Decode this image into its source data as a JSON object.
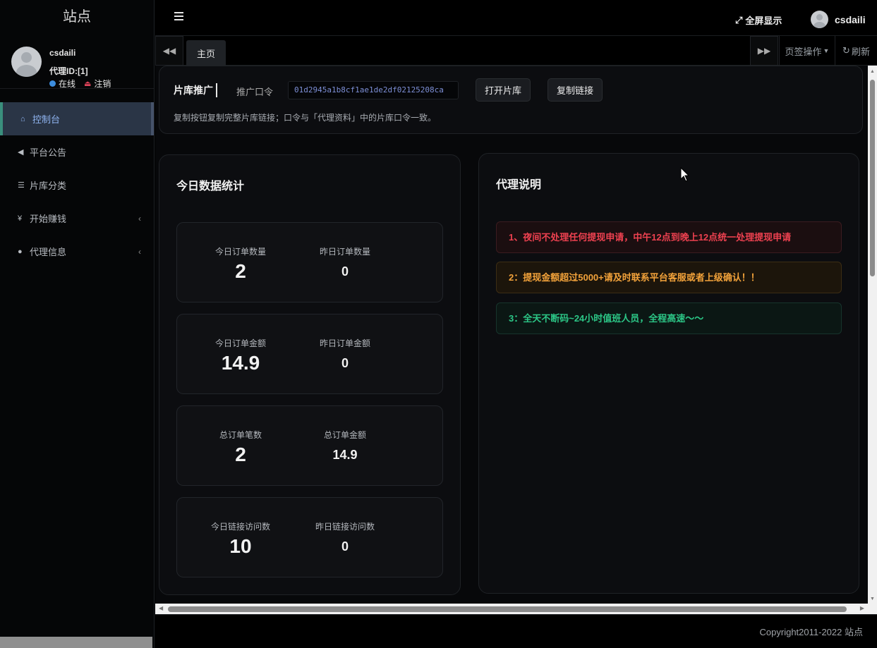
{
  "sidebar": {
    "logo": "站点",
    "user": {
      "name": "csdaili",
      "id_text": "代理ID:[1]",
      "status": "在线",
      "logout": "注销"
    },
    "menu": [
      {
        "label": "控制台",
        "icon": "home-icon",
        "glyph": "⌂",
        "active": true
      },
      {
        "label": "平台公告",
        "icon": "bullhorn-icon",
        "glyph": "◀",
        "active": false
      },
      {
        "label": "片库分类",
        "icon": "list-icon",
        "glyph": "☰",
        "active": false
      },
      {
        "label": "开始赚钱",
        "icon": "yen-icon",
        "glyph": "¥",
        "active": false,
        "expandable": true
      },
      {
        "label": "代理信息",
        "icon": "user-icon",
        "glyph": "●",
        "active": false,
        "expandable": true
      }
    ]
  },
  "header": {
    "fullscreen_label": "全屏显示",
    "user_name": "csdaili"
  },
  "tabbar": {
    "home_tab": "主页",
    "tab_ops": "页签操作",
    "refresh": "刷新"
  },
  "promo": {
    "title": "片库推广",
    "label": "推广口令",
    "code": "01d2945a1b8cf1ae1de2df02125208ca",
    "open_button": "打开片库",
    "copy_button": "复制链接",
    "description": "复制按钮复制完整片库链接；口令与「代理资料」中的片库口令一致。"
  },
  "stats": {
    "title": "今日数据统计",
    "cards": [
      {
        "left_label": "今日订单数量",
        "left_value": "2",
        "right_label": "昨日订单数量",
        "right_value": "0"
      },
      {
        "left_label": "今日订单金额",
        "left_value": "14.9",
        "right_label": "昨日订单金额",
        "right_value": "0"
      },
      {
        "left_label": "总订单笔数",
        "left_value": "2",
        "right_label": "总订单金额",
        "right_value": "14.9"
      },
      {
        "left_label": "今日链接访问数",
        "left_value": "10",
        "right_label": "昨日链接访问数",
        "right_value": "0"
      }
    ]
  },
  "agent_notes": {
    "title": "代理说明",
    "items": [
      {
        "text": "1、夜间不处理任何提现申请，中午12点到晚上12点统一处理提现申请",
        "color": "#ee4150"
      },
      {
        "text": "2：提现金额超过5000+请及时联系平台客服或者上级确认！！",
        "color": "#f2a23a"
      },
      {
        "text": "3：全天不断码~24小时值班人员，全程高速～～",
        "color": "#2cc787"
      }
    ]
  },
  "footer": {
    "copyright": "Copyright2011-2022 站点"
  }
}
